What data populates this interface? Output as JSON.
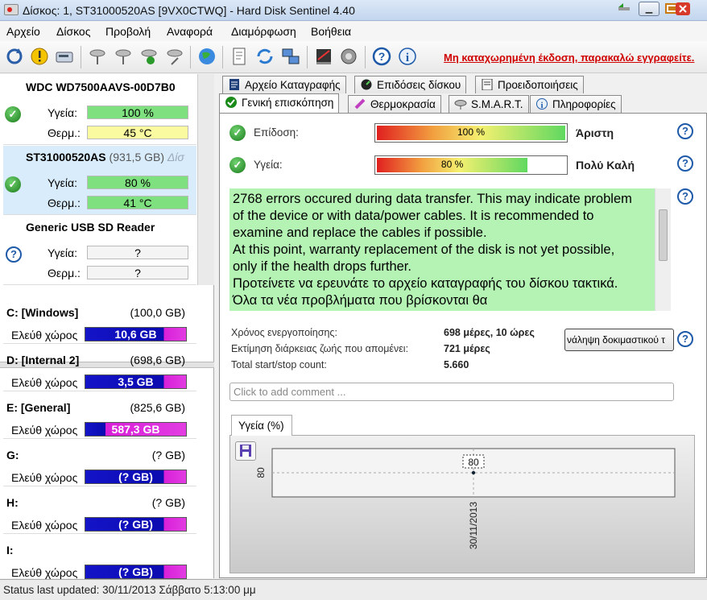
{
  "window": {
    "title": "Δίσκος: 1, ST31000520AS [9VX0CTWQ]  -  Hard Disk Sentinel 4.40"
  },
  "menu": [
    "Αρχείο",
    "Δίσκος",
    "Προβολή",
    "Αναφορά",
    "Διαμόρφωση",
    "Βοήθεια"
  ],
  "toolbar": {
    "registration_notice": "Μη καταχωρημένη έκδοση, παρακαλώ εγγραφείτε."
  },
  "disks": [
    {
      "name": "WDC WD7500AAVS-00D7B0",
      "size": "",
      "health_label": "Υγεία:",
      "health": "100 %",
      "temp_label": "Θερμ.:",
      "temp": "45 °C"
    },
    {
      "name": "ST31000520AS",
      "size": "(931,5 GB)",
      "size_suffix": "Δίσ",
      "health_label": "Υγεία:",
      "health": "80 %",
      "temp_label": "Θερμ.:",
      "temp": "41 °C"
    },
    {
      "name": "Generic USB SD Reader",
      "size": "",
      "health_label": "Υγεία:",
      "health": "?",
      "temp_label": "Θερμ.:",
      "temp": "?"
    }
  ],
  "volumes": [
    {
      "name": "C: [Windows]",
      "size": "(100,0 GB)",
      "free_label": "Ελεύθ χώρος",
      "free": "10,6 GB"
    },
    {
      "name": "D: [Internal 2]",
      "size": "(698,6 GB)",
      "free_label": "Ελεύθ χώρος",
      "free": "3,5 GB"
    },
    {
      "name": "E: [General]",
      "size": "(825,6 GB)",
      "free_label": "Ελεύθ χώρος",
      "free": "587,3 GB"
    },
    {
      "name": "G:",
      "size": "(? GB)",
      "free_label": "Ελεύθ χώρος",
      "free": "(? GB)"
    },
    {
      "name": "H:",
      "size": "(? GB)",
      "free_label": "Ελεύθ χώρος",
      "free": "(? GB)"
    },
    {
      "name": "I:",
      "size": "(? GB)",
      "free_label": "Ελεύθ χώρος",
      "free": "(? GB)"
    }
  ],
  "tabs": {
    "row1": [
      "Αρχείο Καταγραφής",
      "Επιδόσεις δίσκου",
      "Προειδοποιήσεις"
    ],
    "row2": [
      "Γενική επισκόπηση",
      "Θερμοκρασία",
      "S.M.A.R.T.",
      "Πληροφορίες"
    ]
  },
  "overview": {
    "performance_label": "Επίδοση:",
    "performance_value": "100 %",
    "performance_grade": "Άριστη",
    "health_label": "Υγεία:",
    "health_value": "80 %",
    "health_grade": "Πολύ Καλή",
    "message": "2768 errors occured during data transfer. This may indicate problem of the device or with data/power cables. It is recommended to examine and replace the cables if possible.\nAt this point, warranty replacement of the disk is not yet possible, only if the health drops further.\nΠροτείνετε να ερευνάτε το αρχείο καταγραφής του δίσκου τακτικά. Όλα τα νέα προβλήματα που βρίσκονται θα",
    "power_on_label": "Χρόνος ενεργοποίησης:",
    "power_on_value": "698 μέρες, 10 ώρες",
    "lifetime_label": "Εκτίμηση διάρκειας ζωής που απομένει:",
    "lifetime_value": "721 μέρες",
    "startstop_label": "Total start/stop count:",
    "startstop_value": "5.660",
    "test_button": "νάληψη δοκιμαστικού τ",
    "comment_placeholder": "Click to add comment ..."
  },
  "chart_tab": "Υγεία (%)",
  "chart_data": {
    "type": "line",
    "title": "",
    "x": [
      "30/11/2013"
    ],
    "series": [
      {
        "values": [
          80
        ]
      }
    ],
    "ylabel": "",
    "ytick_labels": [
      "80"
    ],
    "data_labels": [
      "80"
    ]
  },
  "status": "Status last updated: 30/11/2013 Σάββατο 5:13:00 μμ",
  "colors": {
    "health_good": "#7ee07e",
    "temp_warm": "#fafaa0",
    "volume_used": "#1414c8",
    "volume_free": "#d81fd8",
    "warning_text": "#d00000",
    "message_bg": "#b4f3b4"
  }
}
